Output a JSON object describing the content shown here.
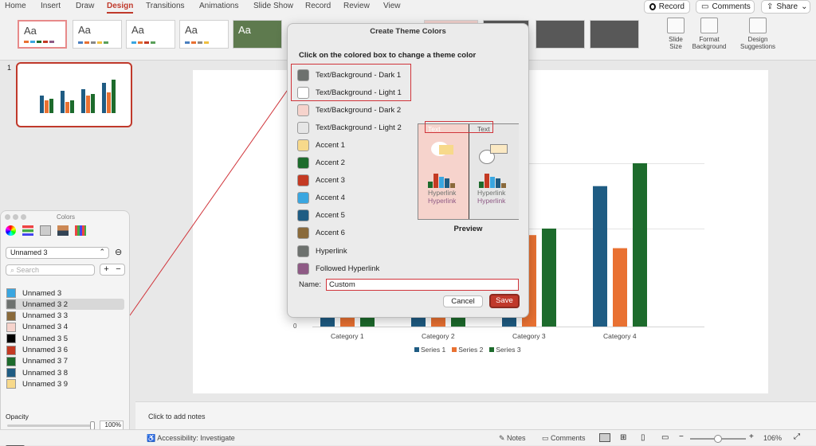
{
  "ribbon": {
    "tabs": [
      "Home",
      "Insert",
      "Draw",
      "Design",
      "Transitions",
      "Animations",
      "Slide Show",
      "Record",
      "Review",
      "View"
    ],
    "record_label": "Record",
    "comments_label": "Comments",
    "share_label": "Share",
    "slide_size_label": "Slide Size",
    "format_bg_label": "Format Background",
    "design_suggestions_label": "Design Suggestions",
    "theme_label": "Aa"
  },
  "slide_panel": {
    "number": "1"
  },
  "chart_data": {
    "type": "bar",
    "categories": [
      "Category 1",
      "Category 2",
      "Category 3",
      "Category 4"
    ],
    "series": [
      {
        "name": "Series 1",
        "values": [
          0.3,
          0.3,
          0.3,
          4.3
        ],
        "color": "#1f5c83"
      },
      {
        "name": "Series 2",
        "values": [
          0.3,
          0.3,
          2.8,
          2.4
        ],
        "color": "#e97132"
      },
      {
        "name": "Series 3",
        "values": [
          0.3,
          0.3,
          3.0,
          5.0
        ],
        "color": "#1d6b2c"
      }
    ],
    "y_tick_visible": "0"
  },
  "notes_placeholder": "Click to add notes",
  "colors_panel": {
    "title": "Colors",
    "palette_name": "Unnamed 3",
    "search_placeholder": "Search",
    "items": [
      {
        "label": "Unnamed 3",
        "color": "#3aa6e0"
      },
      {
        "label": "Unnamed 3 2",
        "color": "#6d716e"
      },
      {
        "label": "Unnamed 3 3",
        "color": "#8a6a3b"
      },
      {
        "label": "Unnamed 3 4",
        "color": "#f6d3cc"
      },
      {
        "label": "Unnamed 3 5",
        "color": "#000000"
      },
      {
        "label": "Unnamed 3 6",
        "color": "#c43a23"
      },
      {
        "label": "Unnamed 3 7",
        "color": "#1d6b2c"
      },
      {
        "label": "Unnamed 3 8",
        "color": "#1f5c83"
      },
      {
        "label": "Unnamed 3 9",
        "color": "#f7d98b"
      }
    ],
    "opacity_label": "Opacity",
    "opacity_value": "100%"
  },
  "dialog": {
    "title": "Create Theme Colors",
    "instruction": "Click on the colored box to change a theme color",
    "items": [
      {
        "label": "Text/Background - Dark 1",
        "color": "#6d716e"
      },
      {
        "label": "Text/Background - Light 1",
        "color": "#ffffff"
      },
      {
        "label": "Text/Background - Dark 2",
        "color": "#f6d3cc"
      },
      {
        "label": "Text/Background - Light 2",
        "color": "#e6e6e6"
      },
      {
        "label": "Accent 1",
        "color": "#f7d98b"
      },
      {
        "label": "Accent 2",
        "color": "#1d6b2c"
      },
      {
        "label": "Accent 3",
        "color": "#c43a23"
      },
      {
        "label": "Accent 4",
        "color": "#3aa6e0"
      },
      {
        "label": "Accent 5",
        "color": "#1f5c83"
      },
      {
        "label": "Accent 6",
        "color": "#8a6a3b"
      },
      {
        "label": "Hyperlink",
        "color": "#6d716e"
      },
      {
        "label": "Followed Hyperlink",
        "color": "#8e5a85"
      }
    ],
    "preview_label": "Preview",
    "preview_text": "Text",
    "preview_text_light": "Text",
    "hyperlink": "Hyperlink",
    "name_label": "Name:",
    "name_value": "Custom",
    "cancel_label": "Cancel",
    "save_label": "Save"
  },
  "status": {
    "accessibility": "Accessibility: Investigate",
    "notes": "Notes",
    "comments": "Comments",
    "zoom": "106%"
  }
}
